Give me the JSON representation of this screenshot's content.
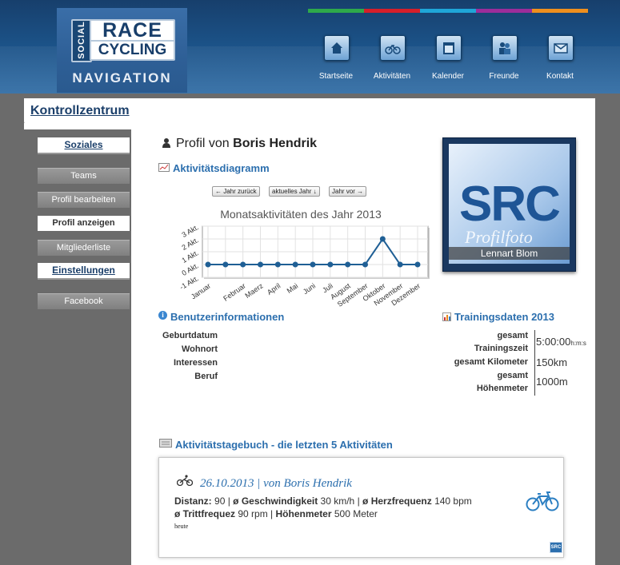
{
  "header": {
    "logo": {
      "social": "SOCIAL",
      "race": "RACE",
      "cycling": "CYCLING",
      "navigation": "NAVIGATION"
    },
    "stripes": [
      "#2ea94a",
      "#d61f2a",
      "#1fa6d8",
      "#9c2d9a",
      "#ef8f1d"
    ],
    "nav": [
      {
        "label": "Startseite",
        "icon": "home-icon"
      },
      {
        "label": "Aktivitäten",
        "icon": "bicycle-icon"
      },
      {
        "label": "Kalender",
        "icon": "calendar-icon"
      },
      {
        "label": "Freunde",
        "icon": "friends-icon"
      },
      {
        "label": "Kontakt",
        "icon": "envelope-icon"
      }
    ]
  },
  "control_center": "Kontrollzentrum",
  "sidebar": {
    "soziales": "Soziales",
    "items": [
      "Teams",
      "Profil bearbeiten",
      "Profil anzeigen",
      "Mitgliederliste"
    ],
    "einstellungen": "Einstellungen",
    "facebook": "Facebook"
  },
  "profile": {
    "prefix": "Profil von",
    "name": "Boris Hendrik",
    "photo_logo": "SRC",
    "photo_overlay": "Profilfoto",
    "photo_caption": "Lennart Blom"
  },
  "activity_chart_section": {
    "heading": "Aktivitätsdiagramm",
    "buttons": [
      "← Jahr zurück",
      "aktuelles Jahr ↓",
      "Jahr vor →"
    ]
  },
  "chart_data": {
    "type": "line",
    "title": "Monatsaktivitäten des Jahr 2013",
    "categories": [
      "Januar",
      "Februar",
      "Maerz",
      "April",
      "Mai",
      "Juni",
      "Juli",
      "August",
      "September",
      "Oktober",
      "November",
      "Dezember"
    ],
    "series": [
      {
        "values": [
          0,
          0,
          0,
          0,
          0,
          0,
          0,
          0,
          0,
          0,
          2,
          0,
          0
        ]
      }
    ],
    "x_points": [
      "Januar",
      "",
      "Februar",
      "Maerz",
      "April",
      "Mai",
      "Juni",
      "Juli",
      "August",
      "September",
      "Oktober",
      "November",
      "Dezember"
    ],
    "yticks": [
      "3 Akt.",
      "2 Akt.",
      "1 Akt.",
      "0 Akt.",
      "-1 Akt."
    ],
    "ylim": [
      -1,
      3
    ],
    "grid": true,
    "color": "#1f5f95"
  },
  "user_info": {
    "heading": "Benutzerinformationen",
    "labels": [
      "Geburtdatum",
      "Wohnort",
      "Interessen",
      "Beruf"
    ]
  },
  "training": {
    "heading": "Trainingsdaten 2013",
    "rows": [
      {
        "label1": "gesamt",
        "label2": "Trainingszeit",
        "value": "5:00:00",
        "unit": "h:m:s"
      },
      {
        "label1": "gesamt Kilometer",
        "label2": "",
        "value": "150km",
        "unit": ""
      },
      {
        "label1": "gesamt",
        "label2": "Höhenmeter",
        "value": "1000m",
        "unit": ""
      }
    ]
  },
  "diary": {
    "heading": "Aktivitätstagebuch - die letzten 5 Aktivitäten",
    "entry": {
      "date_author": "26.10.2013 | von Boris Hendrik",
      "distanz_label": "Distanz:",
      "distanz_value": "90",
      "geschw_label": "ø Geschwindigkeit",
      "geschw_value": "30 km/h",
      "herz_label": "ø Herzfrequenz",
      "herz_value": "140 bpm",
      "tritt_label": "ø Trittfrequez",
      "tritt_value": "90 rpm",
      "hoehe_label": "Höhenmeter",
      "hoehe_value": "500 Meter",
      "note": "heute",
      "badge": "SRC"
    }
  }
}
